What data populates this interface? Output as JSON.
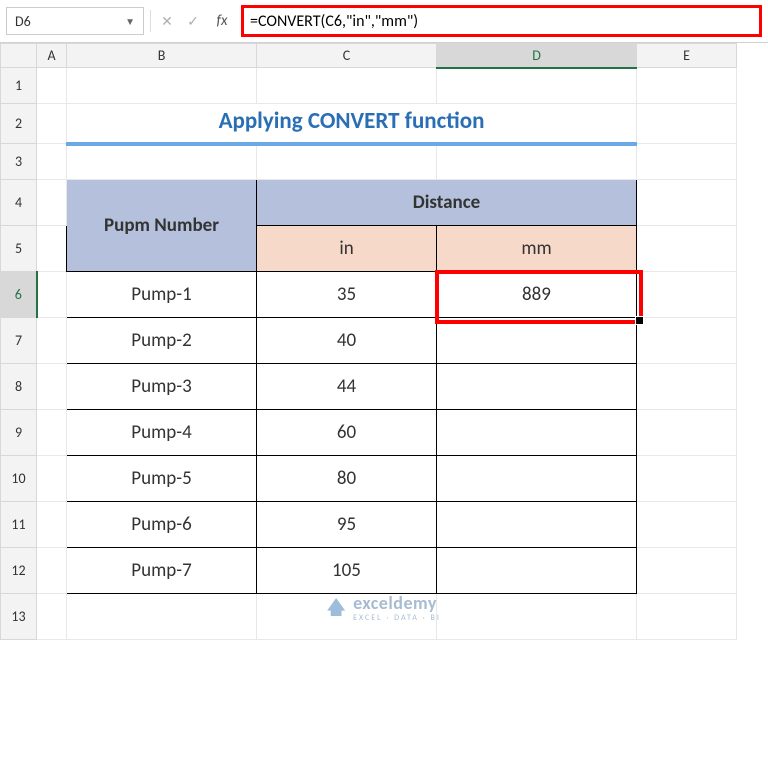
{
  "formula_bar": {
    "cell_ref": "D6",
    "fx_label": "fx",
    "formula": "=CONVERT(C6,\"in\",\"mm\")"
  },
  "columns": [
    "A",
    "B",
    "C",
    "D",
    "E"
  ],
  "rows": [
    "1",
    "2",
    "3",
    "4",
    "5",
    "6",
    "7",
    "8",
    "9",
    "10",
    "11",
    "12",
    "13"
  ],
  "selected_col": "D",
  "selected_row": "6",
  "title": "Applying CONVERT function",
  "table": {
    "header_pump": "Pupm Number",
    "header_distance": "Distance",
    "header_in": "in",
    "header_mm": "mm",
    "rows": [
      {
        "pump": "Pump-1",
        "in": "35",
        "mm": "889"
      },
      {
        "pump": "Pump-2",
        "in": "40",
        "mm": ""
      },
      {
        "pump": "Pump-3",
        "in": "44",
        "mm": ""
      },
      {
        "pump": "Pump-4",
        "in": "60",
        "mm": ""
      },
      {
        "pump": "Pump-5",
        "in": "80",
        "mm": ""
      },
      {
        "pump": "Pump-6",
        "in": "95",
        "mm": ""
      },
      {
        "pump": "Pump-7",
        "in": "105",
        "mm": ""
      }
    ]
  },
  "watermark": {
    "main": "exceldemy",
    "sub": "EXCEL · DATA · BI"
  },
  "chart_data": {
    "type": "table",
    "title": "Applying CONVERT function",
    "columns": [
      "Pupm Number",
      "Distance in",
      "Distance mm"
    ],
    "rows": [
      [
        "Pump-1",
        35,
        889
      ],
      [
        "Pump-2",
        40,
        null
      ],
      [
        "Pump-3",
        44,
        null
      ],
      [
        "Pump-4",
        60,
        null
      ],
      [
        "Pump-5",
        80,
        null
      ],
      [
        "Pump-6",
        95,
        null
      ],
      [
        "Pump-7",
        105,
        null
      ]
    ]
  }
}
